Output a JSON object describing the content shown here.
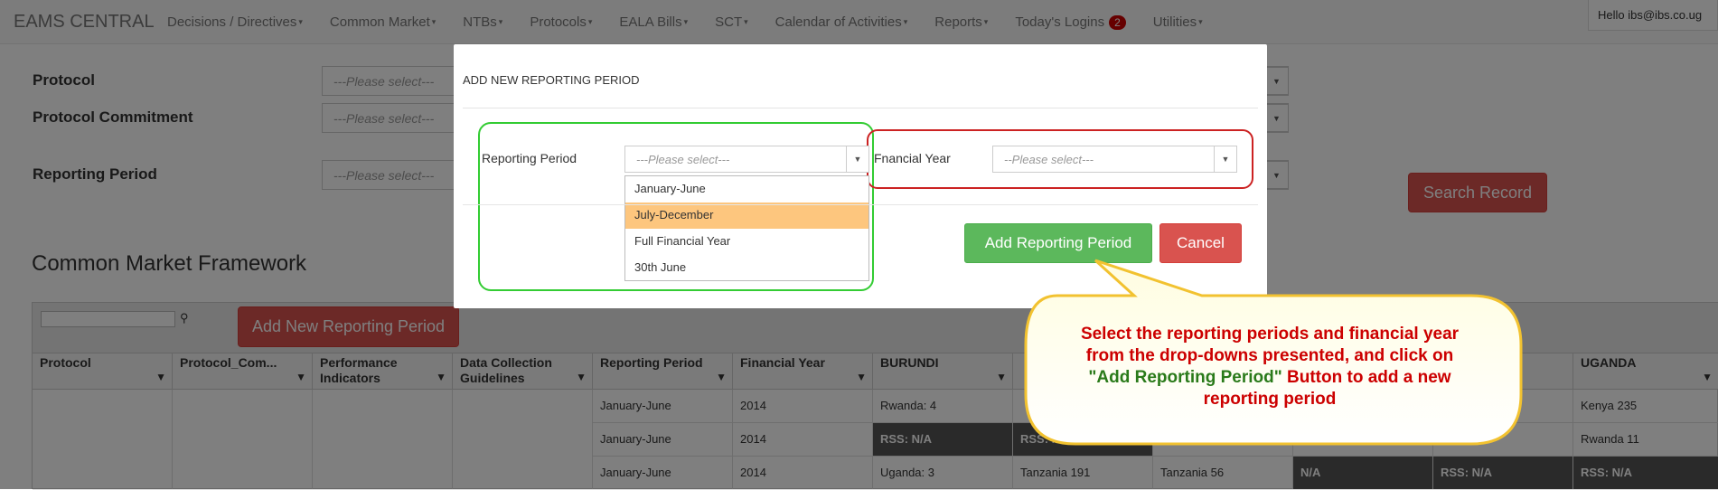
{
  "navbar": {
    "brand": "EAMS CENTRAL",
    "items": [
      {
        "label": "Decisions / Directives"
      },
      {
        "label": "Common Market"
      },
      {
        "label": "NTBs"
      },
      {
        "label": "Protocols"
      },
      {
        "label": "EALA Bills"
      },
      {
        "label": "SCT"
      },
      {
        "label": "Calendar of Activities"
      },
      {
        "label": "Reports"
      },
      {
        "label": "Today's Logins",
        "badge": "2"
      },
      {
        "label": "Utilities"
      }
    ],
    "user_greeting": "Hello ibs@ibs.co.ug"
  },
  "form": {
    "protocol_label": "Protocol",
    "commitment_label": "Protocol Commitment",
    "period_label": "Reporting Period",
    "placeholder": "---Please select---",
    "search_button": "Search Record"
  },
  "section_title": "Common Market Framework",
  "add_button": "Add New Reporting Period",
  "grid": {
    "columns": [
      "Protocol",
      "Protocol_Com...",
      "Performance Indicators",
      "Data Collection Guidelines",
      "Reporting Period",
      "Financial Year",
      "BURUNDI",
      "",
      "",
      "",
      "",
      "UGANDA"
    ],
    "rows": [
      [
        "January-June",
        "2014",
        "Rwanda: 4",
        "",
        "",
        "",
        "",
        "Kenya 235"
      ],
      [
        "January-June",
        "2014",
        "RSS: N/A",
        "RSS: N/A",
        "",
        "",
        "",
        "Rwanda 11"
      ],
      [
        "January-June",
        "2014",
        "Uganda: 3",
        "Tanzania 191",
        "Tanzania 56",
        "N/A",
        "RSS: N/A",
        "RSS: N/A"
      ]
    ]
  },
  "modal": {
    "title": "ADD NEW REPORTING PERIOD",
    "reporting_period_label": "Reporting Period",
    "reporting_period_placeholder": "---Please select---",
    "financial_year_label": "Fnancial Year",
    "financial_year_placeholder": "--Please select---",
    "options": [
      "January-June",
      "July-December",
      "Full Financial Year",
      "30th June"
    ],
    "selected_option": "July-December",
    "add_button": "Add Reporting Period",
    "cancel_button": "Cancel"
  },
  "callout": {
    "line1": "Select the reporting periods and financial year",
    "line2": "from the drop-downs presented, and click on",
    "line3_quote": "\"Add Reporting Period\"",
    "line3_rest": " Button to add a new",
    "line4": "reporting period",
    "highlight_green": "#33cc33",
    "highlight_red": "#cc2222"
  }
}
